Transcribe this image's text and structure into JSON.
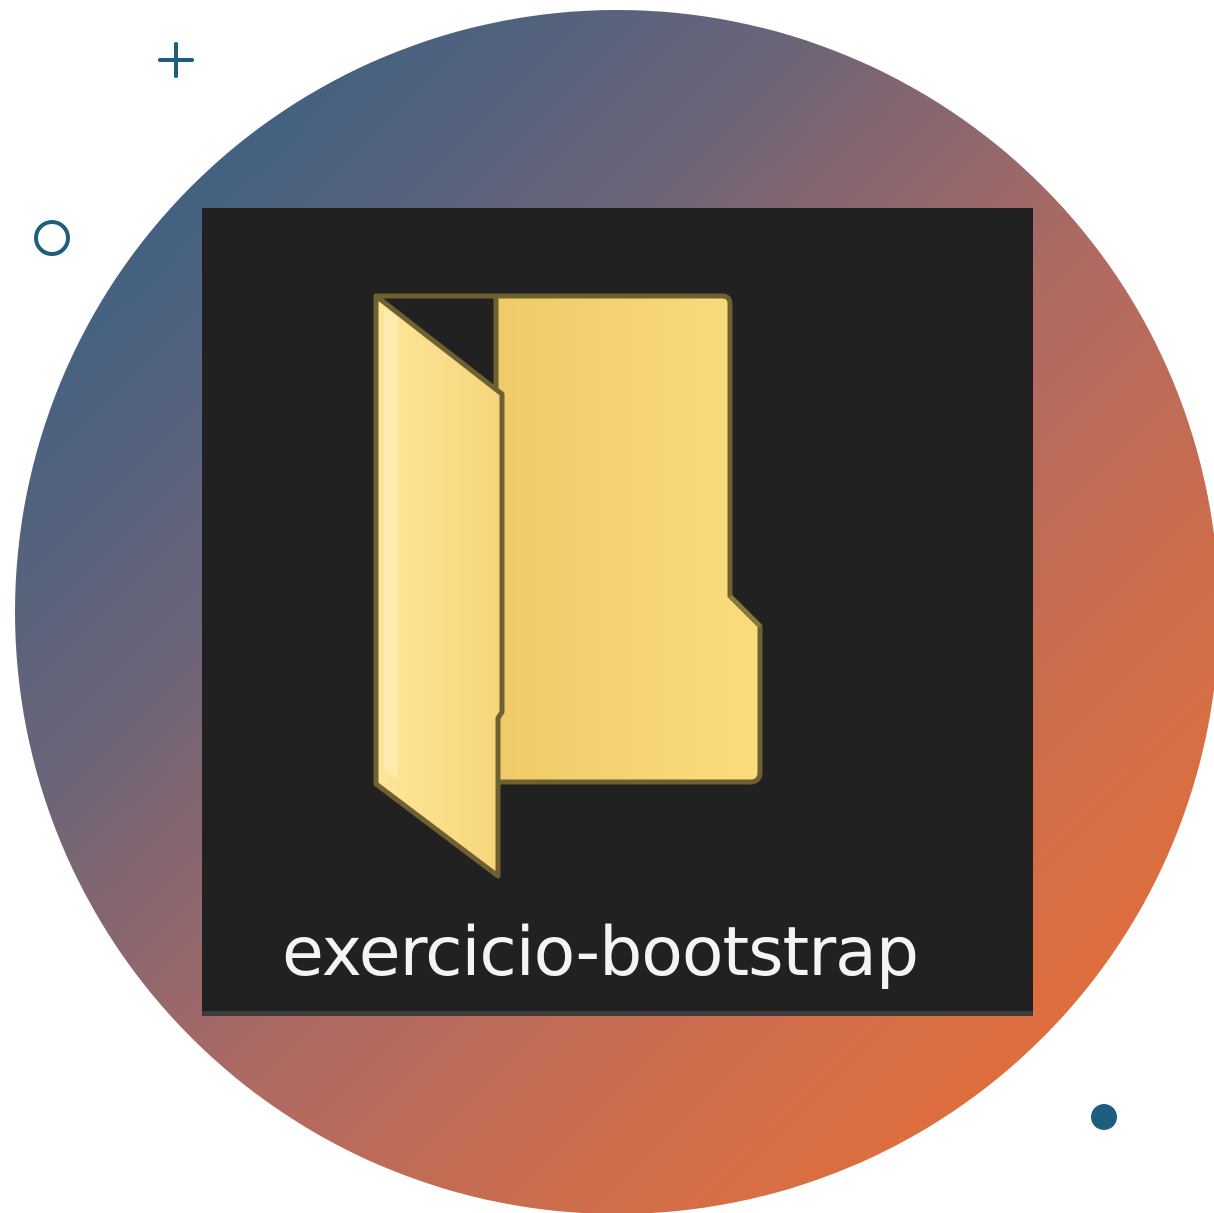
{
  "desktop": {
    "folder": {
      "label": "exercicio-bootstrap",
      "icon": "folder-icon"
    }
  },
  "decorations": {
    "items": [
      "plus-icon",
      "ring-icon",
      "dot-icon"
    ]
  },
  "colors": {
    "tile_background": "#212121",
    "folder_front": "#fbd878",
    "folder_back": "#f0c96a",
    "label_text": "#f4f4f4",
    "decoration_accent": "#1e5d7d",
    "gradient_start": "#235f86",
    "gradient_end": "#ee6c2e"
  }
}
